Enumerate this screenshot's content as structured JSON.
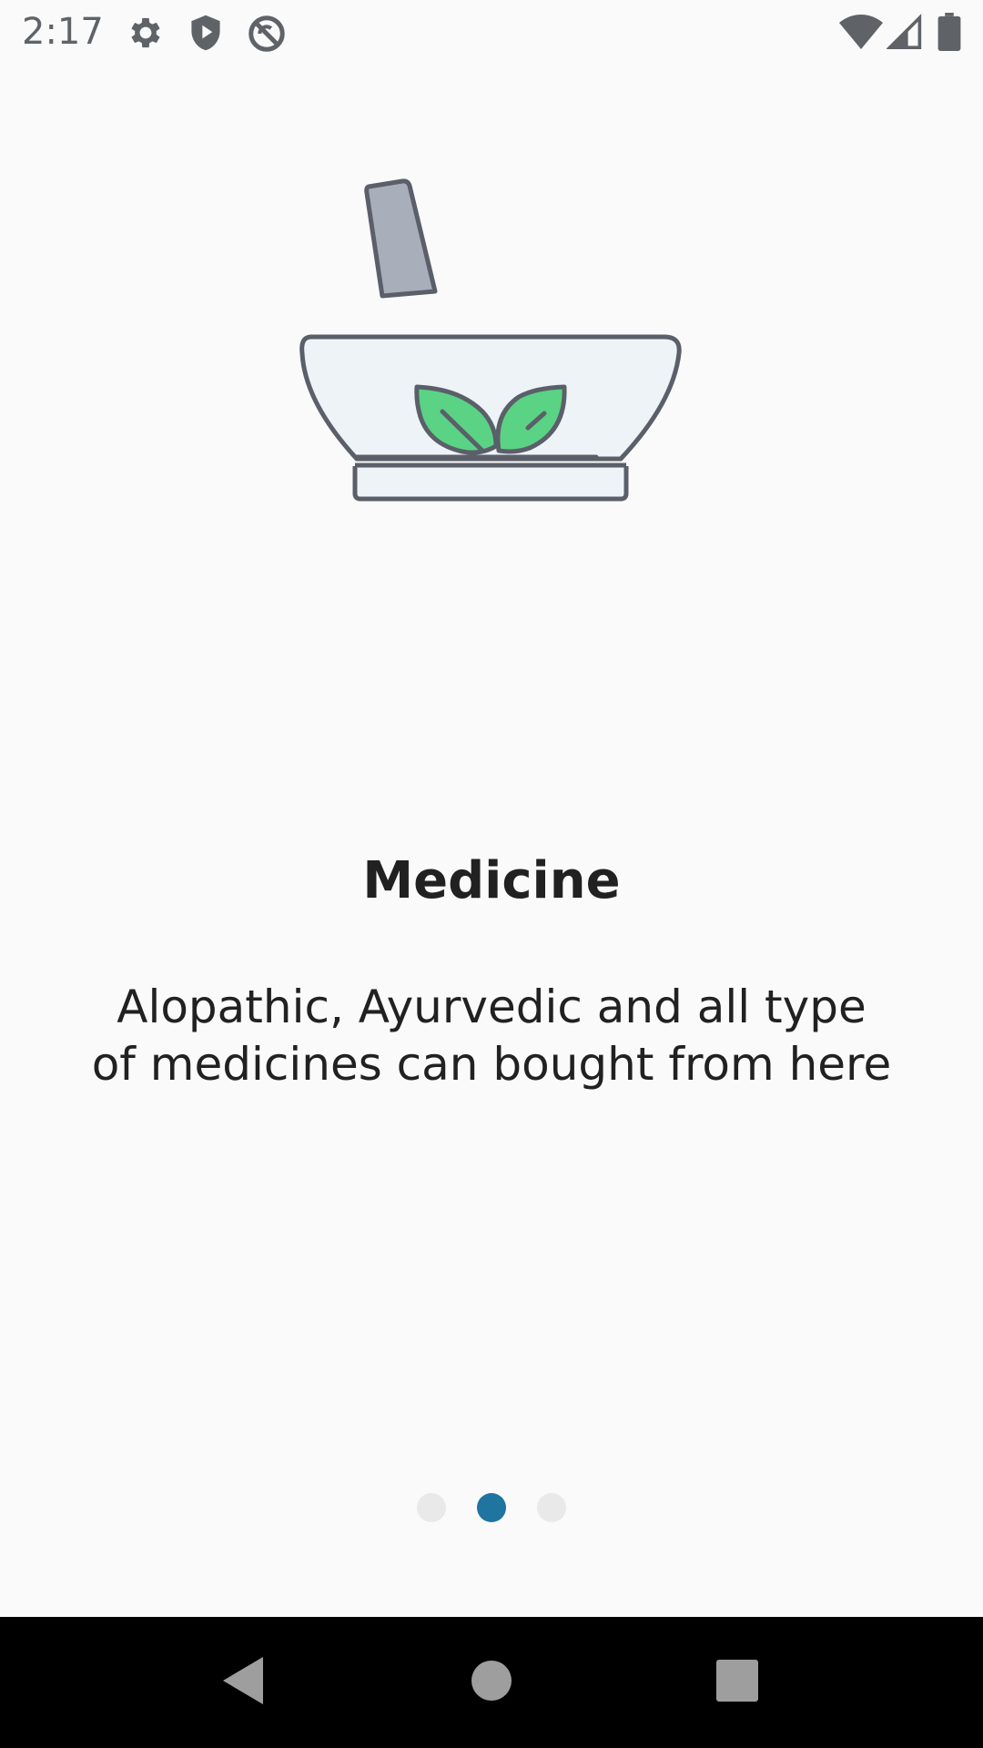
{
  "status_bar": {
    "time": "2:17",
    "left_icons": [
      "gear-icon",
      "shield-play-icon",
      "no-sync-icon"
    ],
    "right_icons": [
      "wifi-icon",
      "signal-icon",
      "battery-icon"
    ]
  },
  "onboarding": {
    "illustration": "mortar-pestle-herbs-icon",
    "title": "Medicine",
    "description": "Alopathic, Ayurvedic and all type of medicines can bought from here",
    "pager": {
      "total": 3,
      "active_index": 1
    }
  },
  "colors": {
    "background": "#fafafa",
    "text": "#212121",
    "dot_active": "#1f74a0",
    "dot_inactive": "#e9e9e9",
    "leaf": "#5ad384",
    "bowl": "#edf3f7",
    "outline": "#5b5f69",
    "pestle": "#a9afba"
  },
  "nav_bar": {
    "buttons": [
      "back-icon",
      "home-icon",
      "recents-icon"
    ]
  }
}
